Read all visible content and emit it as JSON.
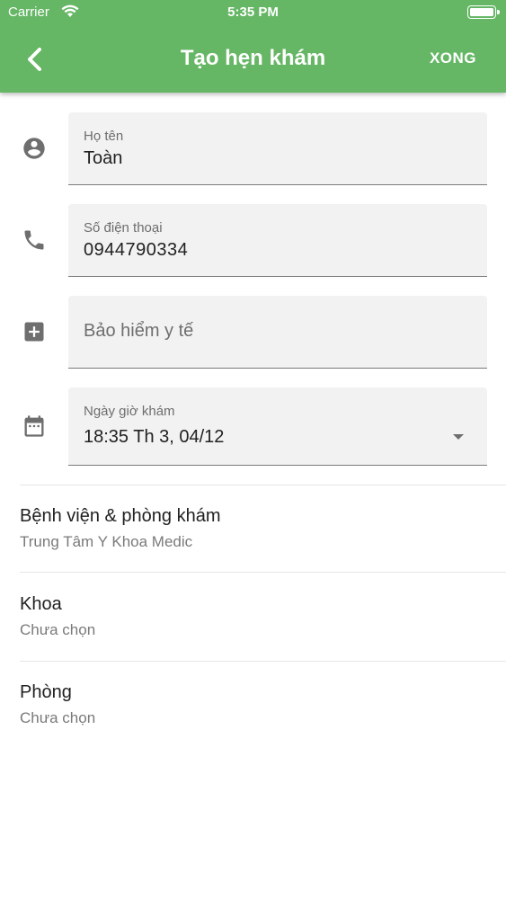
{
  "status_bar": {
    "carrier": "Carrier",
    "time": "5:35 PM"
  },
  "app_bar": {
    "title": "Tạo hẹn khám",
    "done_label": "XONG",
    "color": "#65b665"
  },
  "form": {
    "name": {
      "label": "Họ tên",
      "value": "Toàn",
      "icon": "person-icon"
    },
    "phone": {
      "label": "Số điện thoại",
      "value": "0944790334",
      "icon": "phone-icon"
    },
    "insurance": {
      "placeholder": "Bảo hiểm y tế",
      "icon": "medical-cross-icon"
    },
    "datetime": {
      "label": "Ngày giờ khám",
      "value": "18:35 Th 3, 04/12",
      "icon": "calendar-icon"
    }
  },
  "list": [
    {
      "title": "Bệnh viện & phòng khám",
      "subtitle": "Trung Tâm Y Khoa Medic"
    },
    {
      "title": "Khoa",
      "subtitle": "Chưa chọn"
    },
    {
      "title": "Phòng",
      "subtitle": "Chưa chọn"
    }
  ]
}
